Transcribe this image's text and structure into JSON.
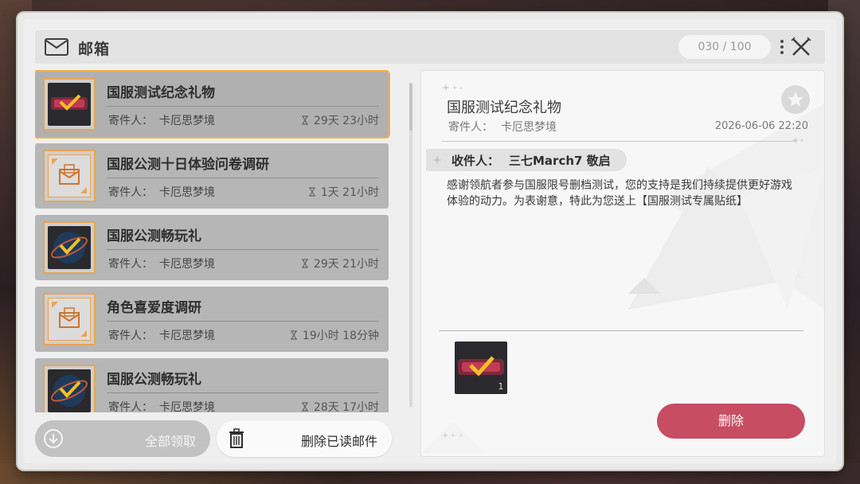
{
  "header": {
    "title": "邮箱",
    "counter": "030 / 100"
  },
  "mail_list": [
    {
      "title": "国服测试纪念礼物",
      "sender_label": "寄件人：",
      "sender": "卡厄思梦境",
      "time_left": "29天 23小时",
      "thumb": "sticker-item",
      "selected": true
    },
    {
      "title": "国服公测十日体验问卷调研",
      "sender_label": "寄件人：",
      "sender": "卡厄思梦境",
      "time_left": "1天 21小时",
      "thumb": "survey-envelope",
      "selected": false
    },
    {
      "title": "国服公测畅玩礼",
      "sender_label": "寄件人：",
      "sender": "卡厄思梦境",
      "time_left": "29天 21小时",
      "thumb": "gift-item",
      "selected": false
    },
    {
      "title": "角色喜爱度调研",
      "sender_label": "寄件人：",
      "sender": "卡厄思梦境",
      "time_left": "19小时 18分钟",
      "thumb": "survey-envelope",
      "selected": false
    },
    {
      "title": "国服公测畅玩礼",
      "sender_label": "寄件人：",
      "sender": "卡厄思梦境",
      "time_left": "28天 17小时",
      "thumb": "gift-item",
      "selected": false
    }
  ],
  "buttons": {
    "claim_all": "全部领取",
    "delete_read": "删除已读邮件"
  },
  "detail": {
    "title": "国服测试纪念礼物",
    "sender_label": "寄件人：",
    "sender": "卡厄思梦境",
    "date": "2026-06-06 22:20",
    "recipient_label": "收件人：",
    "recipient": "三七March7 敬启",
    "body": "感谢领航者参与国服限号删档测试，您的支持是我们持续提供更好游戏体验的动力。为表谢意，特此为您送上【国服测试专属贴纸】",
    "attachment_qty": "1",
    "delete_label": "删除"
  },
  "colors": {
    "accent_selected": "#f4b03e",
    "delete_button": "#c74d63",
    "thumb_border": "#e7a456"
  }
}
